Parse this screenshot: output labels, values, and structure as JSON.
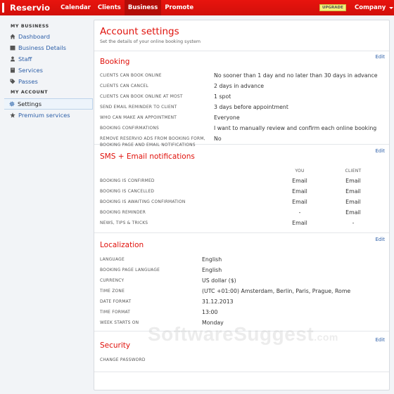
{
  "app": {
    "logo": "Reservio",
    "nav": [
      {
        "label": "Calendar",
        "active": false
      },
      {
        "label": "Clients",
        "active": false
      },
      {
        "label": "Business",
        "active": true
      },
      {
        "label": "Promote",
        "active": false
      }
    ],
    "upgrade_label": "UPGRADE",
    "company_label": "Company"
  },
  "sidebar": {
    "my_business_heading": "MY BUSINESS",
    "business_items": [
      {
        "label": "Dashboard",
        "icon": "home-icon"
      },
      {
        "label": "Business Details",
        "icon": "briefcase-icon"
      },
      {
        "label": "Staff",
        "icon": "user-icon"
      },
      {
        "label": "Services",
        "icon": "book-icon"
      },
      {
        "label": "Passes",
        "icon": "tag-icon"
      }
    ],
    "my_account_heading": "MY ACCOUNT",
    "account_items": [
      {
        "label": "Settings",
        "icon": "gear-icon",
        "active": true
      },
      {
        "label": "Premium services",
        "icon": "star-icon",
        "active": false
      }
    ]
  },
  "main": {
    "title": "Account settings",
    "subtitle": "Set the details of your online booking system",
    "edit_label": "Edit",
    "booking": {
      "title": "Booking",
      "rows": [
        {
          "label": "CLIENTS CAN BOOK ONLINE",
          "value": "No sooner than 1 day and no later than 30 days in advance"
        },
        {
          "label": "CLIENTS CAN CANCEL",
          "value": "2 days in advance"
        },
        {
          "label": "CLIENTS CAN BOOK ONLINE AT MOST",
          "value": "1 spot"
        },
        {
          "label": "SEND EMAIL REMINDER TO CLIENT",
          "value": "3 days before appointment"
        },
        {
          "label": "WHO CAN MAKE AN APPOINTMENT",
          "value": "Everyone"
        },
        {
          "label": "BOOKING CONFIRMATIONS",
          "value": "I want to manually review and confirm each online booking"
        },
        {
          "label_line1": "REMOVE RESERVIO ADS FROM BOOKING FORM,",
          "label_line2": "BOOKING PAGE AND EMAIL NOTIFICATIONS",
          "value": "No"
        }
      ]
    },
    "notifications": {
      "title": "SMS + Email notifications",
      "columns": [
        "YOU",
        "CLIENT"
      ],
      "rows": [
        {
          "label": "BOOKING IS CONFIRMED",
          "you": "Email",
          "client": "Email"
        },
        {
          "label": "BOOKING IS CANCELLED",
          "you": "Email",
          "client": "Email"
        },
        {
          "label": "BOOKING IS AWAITING CONFIRMATION",
          "you": "Email",
          "client": "Email"
        },
        {
          "label": "BOOKING REMINDER",
          "you": "-",
          "client": "Email"
        },
        {
          "label": "NEWS, TIPS & TRICKS",
          "you": "Email",
          "client": "-"
        }
      ]
    },
    "localization": {
      "title": "Localization",
      "rows": [
        {
          "label": "LANGUAGE",
          "value": "English"
        },
        {
          "label": "BOOKING PAGE LANGUAGE",
          "value": "English"
        },
        {
          "label": "CURRENCY",
          "value": "US dollar ($)"
        },
        {
          "label": "TIME ZONE",
          "value": "(UTC +01:00) Amsterdam, Berlin, Paris, Prague, Rome"
        },
        {
          "label": "DATE FORMAT",
          "value": "31.12.2013"
        },
        {
          "label": "TIME FORMAT",
          "value": "13:00"
        },
        {
          "label": "WEEK STARTS ON",
          "value": "Monday"
        }
      ]
    },
    "security": {
      "title": "Security",
      "rows": [
        {
          "label": "CHANGE PASSWORD"
        }
      ]
    }
  },
  "watermark": {
    "main": "SoftwareSuggest",
    "suffix": ".com"
  }
}
